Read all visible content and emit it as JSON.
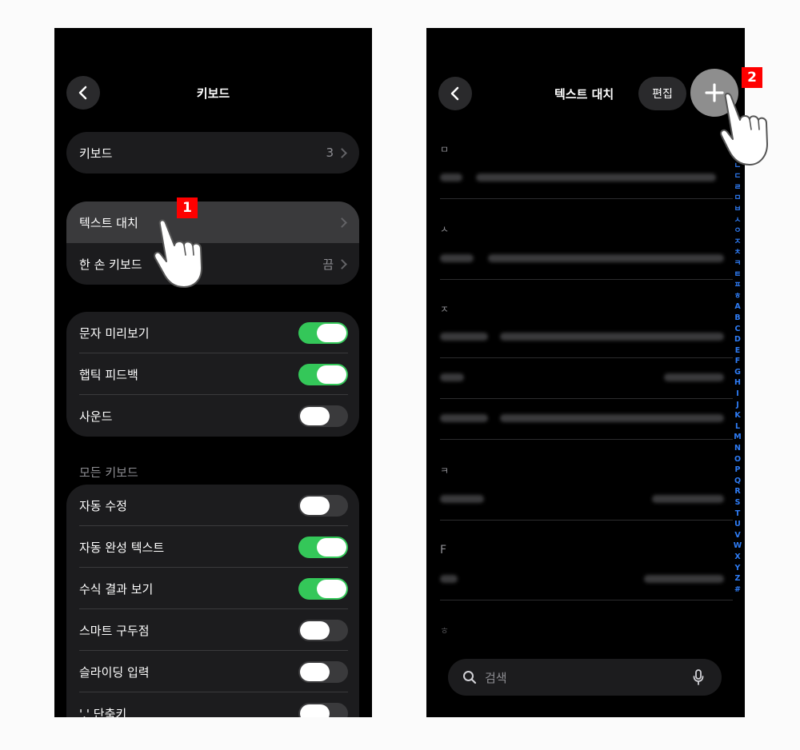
{
  "left": {
    "title": "키보드",
    "group1": [
      {
        "label": "키보드",
        "value": "3"
      }
    ],
    "group2": [
      {
        "label": "텍스트 대치",
        "value": ""
      },
      {
        "label": "한 손 키보드",
        "value": "끔"
      }
    ],
    "group3": [
      {
        "label": "문자 미리보기",
        "on": true
      },
      {
        "label": "햅틱 피드백",
        "on": true
      },
      {
        "label": "사운드",
        "on": false
      }
    ],
    "section_all": "모든 키보드",
    "group4": [
      {
        "label": "자동 수정",
        "on": false
      },
      {
        "label": "자동 완성 텍스트",
        "on": true
      },
      {
        "label": "수식 결과 보기",
        "on": true
      },
      {
        "label": "스마트 구두점",
        "on": false
      },
      {
        "label": "슬라이딩 입력",
        "on": false
      },
      {
        "label": "'.' 단축키",
        "on": false
      }
    ],
    "step_badge": "1"
  },
  "right": {
    "title": "텍스트 대치",
    "edit_label": "편집",
    "step_badge": "2",
    "sections": [
      "ㅁ",
      "ㅅ",
      "ㅈ",
      "ㅋ",
      "F",
      "ㅎ"
    ],
    "index": [
      "ㄱ",
      "ㄴ",
      "ㄷ",
      "ㄹ",
      "ㅁ",
      "ㅂ",
      "ㅅ",
      "ㅇ",
      "ㅈ",
      "ㅊ",
      "ㅋ",
      "ㅌ",
      "ㅍ",
      "ㅎ",
      "A",
      "B",
      "C",
      "D",
      "E",
      "F",
      "G",
      "H",
      "I",
      "J",
      "K",
      "L",
      "M",
      "N",
      "O",
      "P",
      "Q",
      "R",
      "S",
      "T",
      "U",
      "V",
      "W",
      "X",
      "Y",
      "Z",
      "#"
    ],
    "search_placeholder": "검색"
  },
  "colors": {
    "accent_green": "#34c759",
    "index_blue": "#2f7df6",
    "badge_red": "#ff0000"
  },
  "icons": [
    "back-chevron-icon",
    "plus-icon",
    "search-icon",
    "microphone-icon",
    "tap-hand-icon"
  ]
}
